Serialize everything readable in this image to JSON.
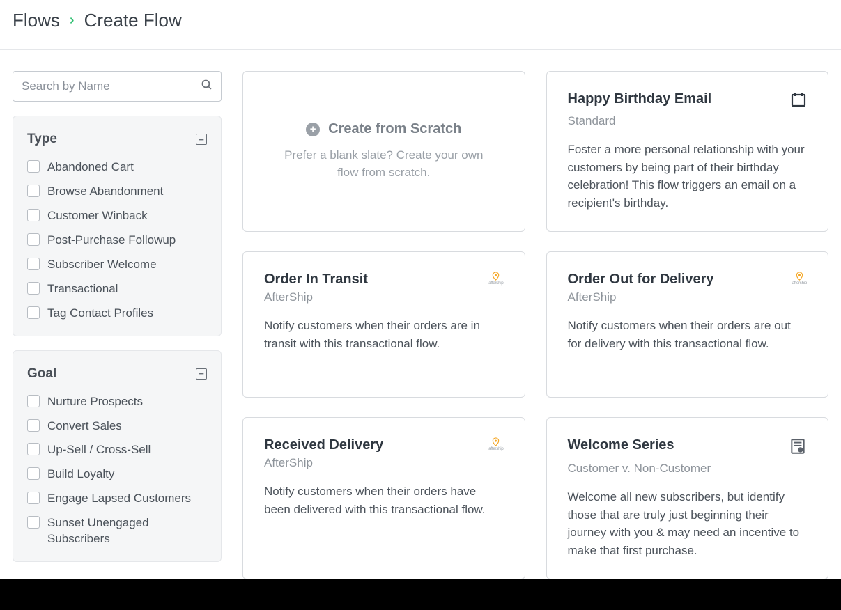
{
  "breadcrumb": {
    "root": "Flows",
    "current": "Create Flow"
  },
  "search": {
    "placeholder": "Search by Name"
  },
  "filters": {
    "type": {
      "title": "Type",
      "items": [
        "Abandoned Cart",
        "Browse Abandonment",
        "Customer Winback",
        "Post-Purchase Followup",
        "Subscriber Welcome",
        "Transactional",
        "Tag Contact Profiles"
      ]
    },
    "goal": {
      "title": "Goal",
      "items": [
        "Nurture Prospects",
        "Convert Sales",
        "Up-Sell / Cross-Sell",
        "Build Loyalty",
        "Engage Lapsed Customers",
        "Sunset Unengaged Subscribers"
      ]
    }
  },
  "scratch": {
    "title": "Create from Scratch",
    "desc": "Prefer a blank slate? Create your own flow from scratch."
  },
  "cards": [
    {
      "title": "Happy Birthday Email",
      "sub": "Standard",
      "icon": "calendar",
      "desc": "Foster a more personal relationship with your customers by being part of their birthday celebration! This flow triggers an email on a recipient's birthday."
    },
    {
      "title": "Order In Transit",
      "sub": "AfterShip",
      "icon": "aftership",
      "desc": "Notify customers when their orders are in transit with this transactional flow."
    },
    {
      "title": "Order Out for Delivery",
      "sub": "AfterShip",
      "icon": "aftership",
      "desc": "Notify customers when their orders are out for delivery with this transactional flow."
    },
    {
      "title": "Received Delivery",
      "sub": "AfterShip",
      "icon": "aftership",
      "desc": "Notify customers when their orders have been delivered with this transactional flow."
    },
    {
      "title": "Welcome Series",
      "sub": "Customer v. Non-Customer",
      "icon": "document",
      "desc": "Welcome all new subscribers, but identify those that are truly just beginning their journey with you & may need an incentive to make that first purchase."
    }
  ]
}
